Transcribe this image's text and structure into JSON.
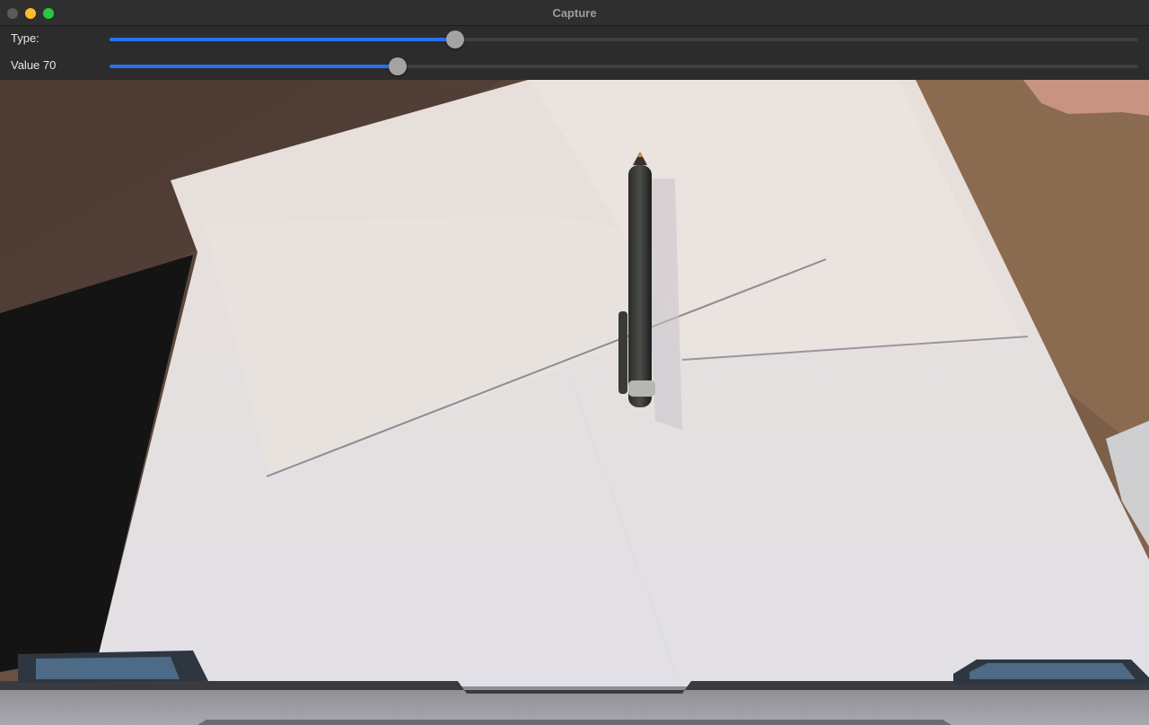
{
  "window": {
    "title": "Capture"
  },
  "controls": {
    "type_slider": {
      "label": "Type:",
      "fraction": 0.336
    },
    "value_slider": {
      "label": "Value 70",
      "fraction": 0.28
    }
  },
  "colors": {
    "accent": "#2a6ff0",
    "window_close": "#5a5a5c",
    "window_minimize": "#febc2e",
    "window_zoom": "#28c840"
  },
  "icons": {
    "close": "close-icon",
    "minimize": "minimize-icon",
    "zoom": "zoom-icon"
  }
}
